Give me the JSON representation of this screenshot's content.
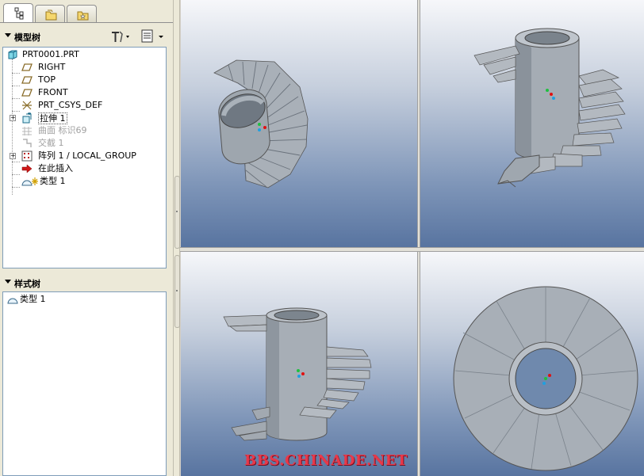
{
  "model_tree": {
    "title": "模型树",
    "items": [
      {
        "label": "PRT0001.PRT"
      },
      {
        "label": "RIGHT"
      },
      {
        "label": "TOP"
      },
      {
        "label": "FRONT"
      },
      {
        "label": "PRT_CSYS_DEF"
      },
      {
        "label": "拉伸 1"
      },
      {
        "label": "曲面 标识69"
      },
      {
        "label": "交截 1"
      },
      {
        "label": "阵列 1 / LOCAL_GROUP"
      },
      {
        "label": "在此插入"
      },
      {
        "label": "类型 1"
      }
    ]
  },
  "style_tree": {
    "title": "样式树",
    "items": [
      {
        "label": "类型 1"
      }
    ]
  },
  "watermark": "BBS.CHINADE.NET",
  "colors": {
    "accent": "#e8394a",
    "model": "#a9b0b8",
    "tree_border": "#7f9db9"
  }
}
